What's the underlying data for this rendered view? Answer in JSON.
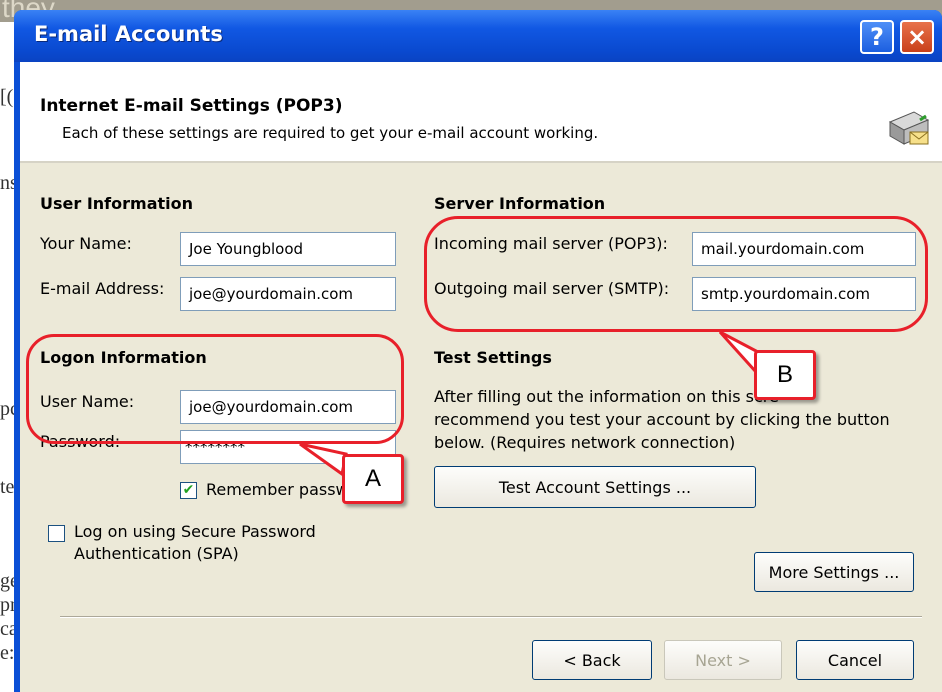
{
  "background": {
    "top_text": "they",
    "left_fragments": [
      "[(",
      "ns",
      "pc",
      "te",
      "ge",
      "pr",
      "ca",
      "e:"
    ]
  },
  "window": {
    "title": "E-mail Accounts",
    "help_glyph": "?",
    "close_glyph": "×"
  },
  "header": {
    "title": "Internet E-mail Settings (POP3)",
    "description": "Each of these settings are required to get your e-mail account working.",
    "icon": "mail-server-icon"
  },
  "user_info": {
    "heading": "User Information",
    "name_label": "Your Name:",
    "name_value": "Joe Youngblood",
    "email_label": "E-mail Address:",
    "email_value": "joe@yourdomain.com"
  },
  "server_info": {
    "heading": "Server Information",
    "incoming_label": "Incoming mail server (POP3):",
    "incoming_value": "mail.yourdomain.com",
    "outgoing_label": "Outgoing mail server (SMTP):",
    "outgoing_value": "smtp.yourdomain.com"
  },
  "logon_info": {
    "heading": "Logon Information",
    "username_label": "User Name:",
    "username_value": "joe@yourdomain.com",
    "password_label": "Password:",
    "password_value": "********",
    "remember_label": "Remember passw",
    "remember_checked": true,
    "spa_label_line1": "Log on using Secure Password",
    "spa_label_line2": "Authentication (SPA)",
    "spa_checked": false
  },
  "test_settings": {
    "heading": "Test Settings",
    "line1": "After filling out the information on this scre",
    "line2": "recommend you test your account by clicking the button",
    "line3": "below. (Requires network connection)",
    "button_label": "Test Account Settings ..."
  },
  "more_settings_label": "More Settings ...",
  "nav": {
    "back_label": "< Back",
    "next_label": "Next >",
    "cancel_label": "Cancel"
  },
  "annotations": {
    "callout_a": "A",
    "callout_b": "B",
    "color": "#e8202a"
  }
}
